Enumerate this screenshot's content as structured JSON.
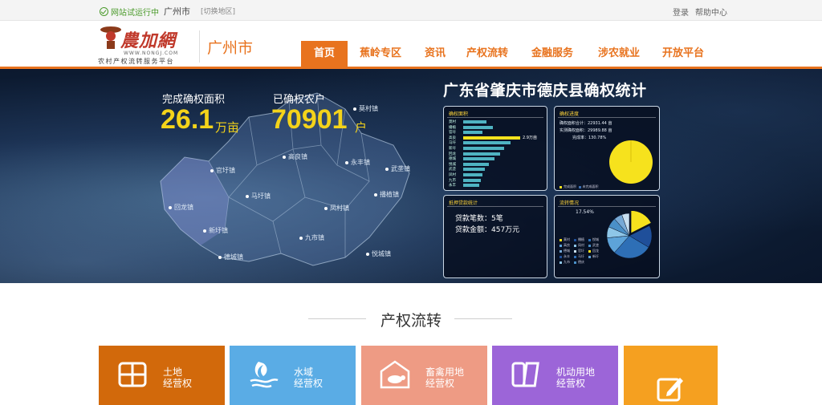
{
  "topbar": {
    "status": "网站试运行中",
    "city": "广州市",
    "switch": "[切换地区]",
    "login": "登录",
    "help": "帮助中心"
  },
  "logo": {
    "name": "農加網",
    "url": "WWW.NONGJ.COM",
    "tagline": "农村产权流转服务平台"
  },
  "header": {
    "city": "广州市"
  },
  "nav": [
    "首页",
    "蕉岭专区",
    "资讯",
    "产权流转",
    "金融服务",
    "涉农就业",
    "开放平台"
  ],
  "banner": {
    "area_label": "完成确权面积",
    "area_value": "26.1",
    "area_unit": "万亩",
    "farmers_label": "已确权农户",
    "farmers_value": "70901",
    "farmers_unit": "户",
    "title": "广东省肇庆市德庆县确权统计",
    "towns": [
      "莫村镇",
      "官圩镇",
      "高良镇",
      "永丰镇",
      "武垄镇",
      "马圩镇",
      "回龙镇",
      "播植镇",
      "凤村镇",
      "新圩镇",
      "九市镇",
      "德城镇",
      "悦城镇"
    ]
  },
  "panels": {
    "area": {
      "title": "确权面积",
      "rows": [
        "莫村",
        "播植",
        "官圩",
        "高良",
        "马圩",
        "新圩",
        "回龙",
        "德城",
        "悦城",
        "武垄",
        "凤村",
        "九市",
        "永丰"
      ],
      "highlight_value": "2.9万亩",
      "chart_data": {
        "type": "bar",
        "categories": [
          "莫村",
          "播植",
          "官圩",
          "高良",
          "马圩",
          "新圩",
          "回龙",
          "德城",
          "悦城",
          "武垄",
          "凤村",
          "九市",
          "永丰"
        ],
        "values": [
          1.2,
          1.5,
          1.0,
          2.9,
          2.4,
          2.1,
          1.9,
          1.6,
          1.3,
          1.1,
          1.0,
          0.9,
          0.8
        ]
      }
    },
    "progress": {
      "title": "确权进度",
      "line1": "确权面积合计：22931.44 亩",
      "line2": "实测确权面积：29989.88 亩",
      "line3": "完成率：130.78%",
      "legend": [
        "完成面积",
        "未完成面积"
      ]
    },
    "loan": {
      "title": "抵押贷款统计",
      "count": "贷款笔数：5笔",
      "amount": "贷款金额：457万元"
    },
    "flow": {
      "title": "流转情况",
      "label": "17.54%",
      "legend": [
        "莫村",
        "播植",
        "悦城",
        "高良",
        "凤村",
        "武垄",
        "德城",
        "官圩",
        "回龙",
        "永丰",
        "马圩",
        "新圩",
        "九市",
        "德庆"
      ],
      "chart_data": {
        "type": "pie",
        "values": [
          17.54,
          16,
          28,
          12,
          8,
          7,
          6,
          5.46
        ],
        "colors": [
          "#f6e21d",
          "#1f4f9a",
          "#2e6fb6",
          "#5da3d9",
          "#8ec6e8",
          "#4a90c8",
          "#77a9d6",
          "#c8dff0"
        ]
      }
    }
  },
  "section": {
    "title": "产权流转",
    "cards": [
      {
        "line1": "土地",
        "line2": "经营权",
        "color": "#d2690b",
        "icon": "land-grid-icon"
      },
      {
        "line1": "水域",
        "line2": "经营权",
        "color": "#5aace5",
        "icon": "fish-water-icon"
      },
      {
        "line1": "畜禽用地",
        "line2": "经营权",
        "color": "#ee9b84",
        "icon": "livestock-barn-icon"
      },
      {
        "line1": "机动用地",
        "line2": "经营权",
        "color": "#9c65d8",
        "icon": "reserve-land-icon"
      },
      {
        "line1": "",
        "line2": "",
        "color": "#f5a020",
        "icon": "edit-form-icon"
      }
    ]
  }
}
